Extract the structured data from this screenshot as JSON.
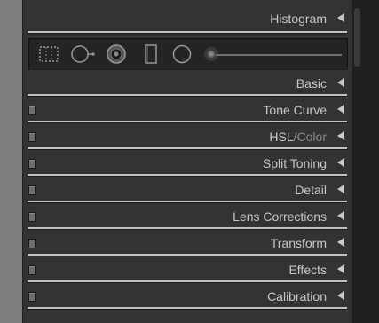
{
  "panel": {
    "histogram": {
      "label": "Histogram"
    },
    "tools": {
      "icons": [
        "crop-overlay-icon",
        "spot-removal-icon",
        "red-eye-icon",
        "graduated-filter-icon",
        "radial-filter-icon",
        "adjustment-brush-icon"
      ],
      "slider_level": 0.0
    },
    "sections": [
      {
        "label": "Basic",
        "toggle": false
      },
      {
        "label": "Tone Curve",
        "toggle": true
      },
      {
        "label_parts": [
          "HSL",
          "/",
          "Color"
        ],
        "toggle": true
      },
      {
        "label": "Split Toning",
        "toggle": true
      },
      {
        "label": "Detail",
        "toggle": true
      },
      {
        "label": "Lens Corrections",
        "toggle": true
      },
      {
        "label": "Transform",
        "toggle": true
      },
      {
        "label": "Effects",
        "toggle": true
      },
      {
        "label": "Calibration",
        "toggle": true
      }
    ]
  },
  "colors": {
    "panel_bg": "#333333",
    "text": "#c8c8c8",
    "dim_text": "#8a8a8a",
    "left_bg": "#7d7d7d",
    "scroll_bg": "#1f1f1f"
  }
}
